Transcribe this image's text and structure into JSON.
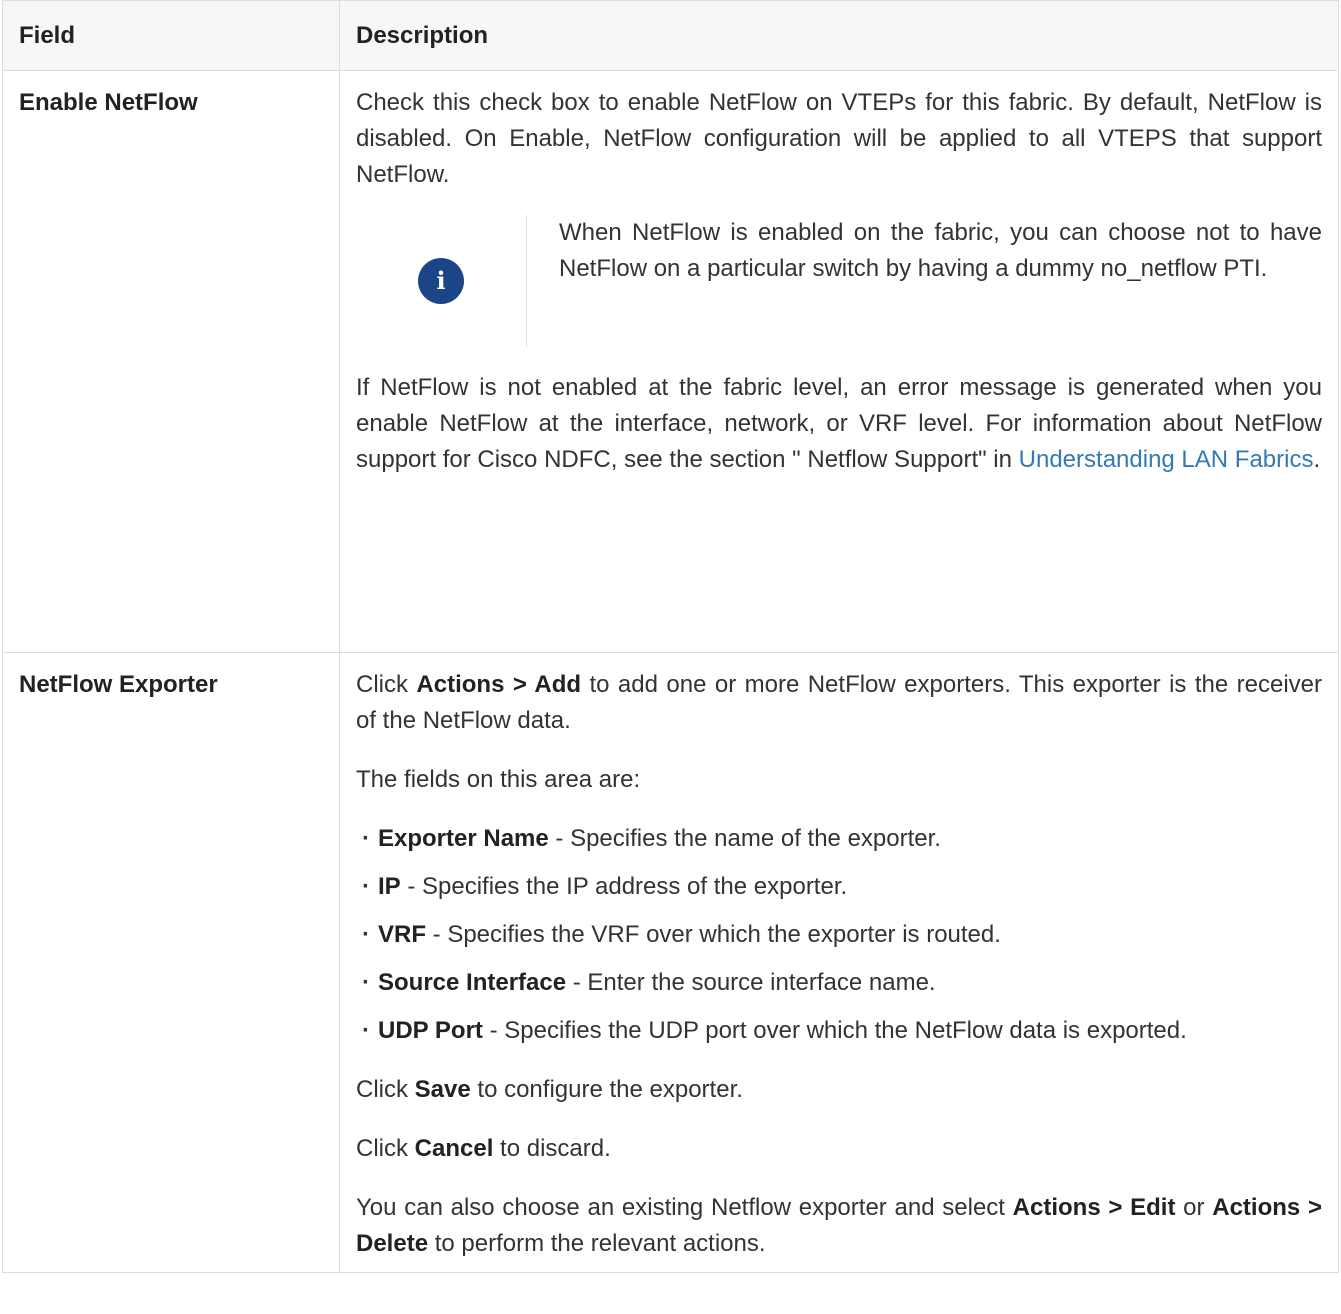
{
  "table": {
    "headers": [
      "Field",
      "Description"
    ],
    "rows": [
      {
        "field": "Enable NetFlow",
        "p1": "Check this check box to enable NetFlow on VTEPs for this fabric. By default, NetFlow is disabled. On Enable, NetFlow configuration will be applied to all VTEPS that support NetFlow.",
        "note_icon": "info-icon",
        "note": "When NetFlow is enabled on the fabric, you can choose not to have NetFlow on a particular switch by having a dummy no_netflow PTI.",
        "p2_text": "If NetFlow is not enabled at the fabric level, an error message is generated when you enable NetFlow at the interface, network, or VRF level. For information about NetFlow support for Cisco NDFC, see the section \" Netflow Support\"  in ",
        "p2_link": "Understanding LAN Fabrics",
        "p2_end": "."
      },
      {
        "field": "NetFlow Exporter",
        "intro_pre": "Click ",
        "intro_actions": "Actions > Add",
        "intro_post": " to add one or more NetFlow exporters. This exporter is the receiver of the NetFlow data.",
        "fields_intro": "The fields on this area are:",
        "items": [
          {
            "term": "Exporter Name",
            "desc": " - Specifies the name of the exporter."
          },
          {
            "term": "IP",
            "desc": " - Specifies the IP address of the exporter."
          },
          {
            "term": "VRF",
            "desc": " - Specifies the VRF over which the exporter is routed."
          },
          {
            "term": "Source Interface",
            "desc": " - Enter the source interface name."
          },
          {
            "term": "UDP Port",
            "desc": " - Specifies the UDP port over which the NetFlow data is exported."
          }
        ],
        "save_pre": "Click ",
        "save_term": "Save",
        "save_post": " to configure the exporter.",
        "cancel_pre": "Click ",
        "cancel_term": "Cancel",
        "cancel_post": " to discard.",
        "last_pre": "You can also choose an existing Netflow exporter and select ",
        "last_term1": "Actions > Edit",
        "last_mid": " or ",
        "last_term2": "Actions > Delete",
        "last_post": " to perform the relevant actions."
      }
    ]
  }
}
